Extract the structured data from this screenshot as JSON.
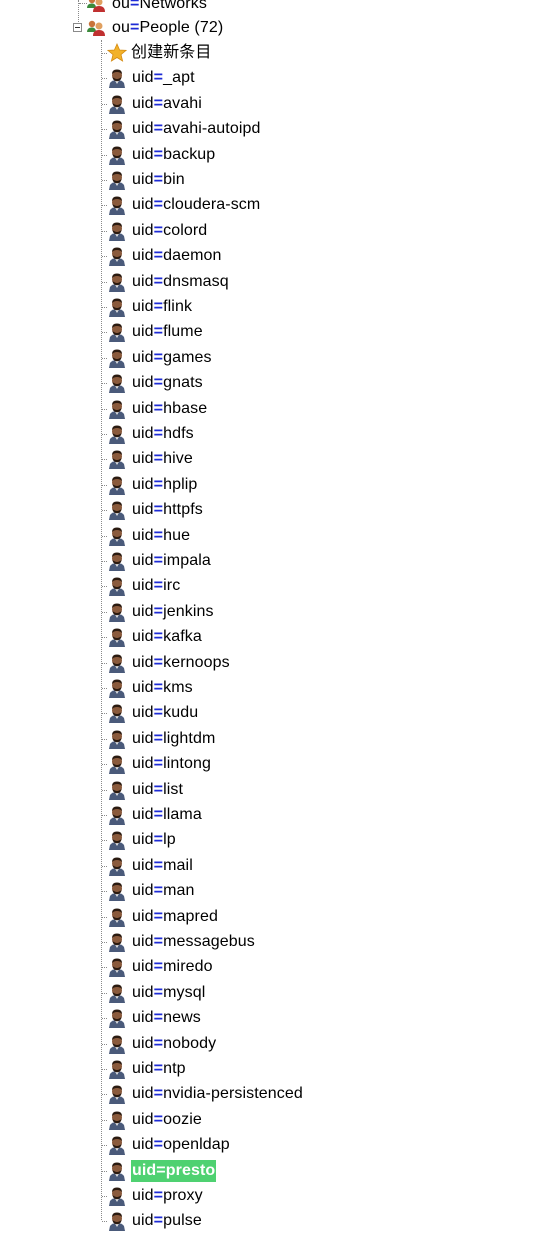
{
  "tree": {
    "parents": [
      {
        "rdn_attr": "ou",
        "rdn_value": "Networks"
      },
      {
        "rdn_attr": "ou",
        "rdn_value": "People (72)"
      }
    ],
    "new_entry_label": "创建新条目",
    "children": [
      "_apt",
      "avahi",
      "avahi-autoipd",
      "backup",
      "bin",
      "cloudera-scm",
      "colord",
      "daemon",
      "dnsmasq",
      "flink",
      "flume",
      "games",
      "gnats",
      "hbase",
      "hdfs",
      "hive",
      "hplip",
      "httpfs",
      "hue",
      "impala",
      "irc",
      "jenkins",
      "kafka",
      "kernoops",
      "kms",
      "kudu",
      "lightdm",
      "lintong",
      "list",
      "llama",
      "lp",
      "mail",
      "man",
      "mapred",
      "messagebus",
      "miredo",
      "mysql",
      "news",
      "nobody",
      "ntp",
      "nvidia-persistenced",
      "oozie",
      "openldap",
      "presto",
      "proxy",
      "pulse"
    ],
    "child_attr": "uid",
    "selected_child": "presto",
    "icons": {
      "group": "ou-group-icon",
      "person": "user-person-icon",
      "new": "star-icon",
      "toggle": "collapse-minus-icon"
    },
    "colors": {
      "equals": "#1d2bd6",
      "selected_bg": "#4fd171",
      "tree_line": "#8a8a8a"
    }
  }
}
